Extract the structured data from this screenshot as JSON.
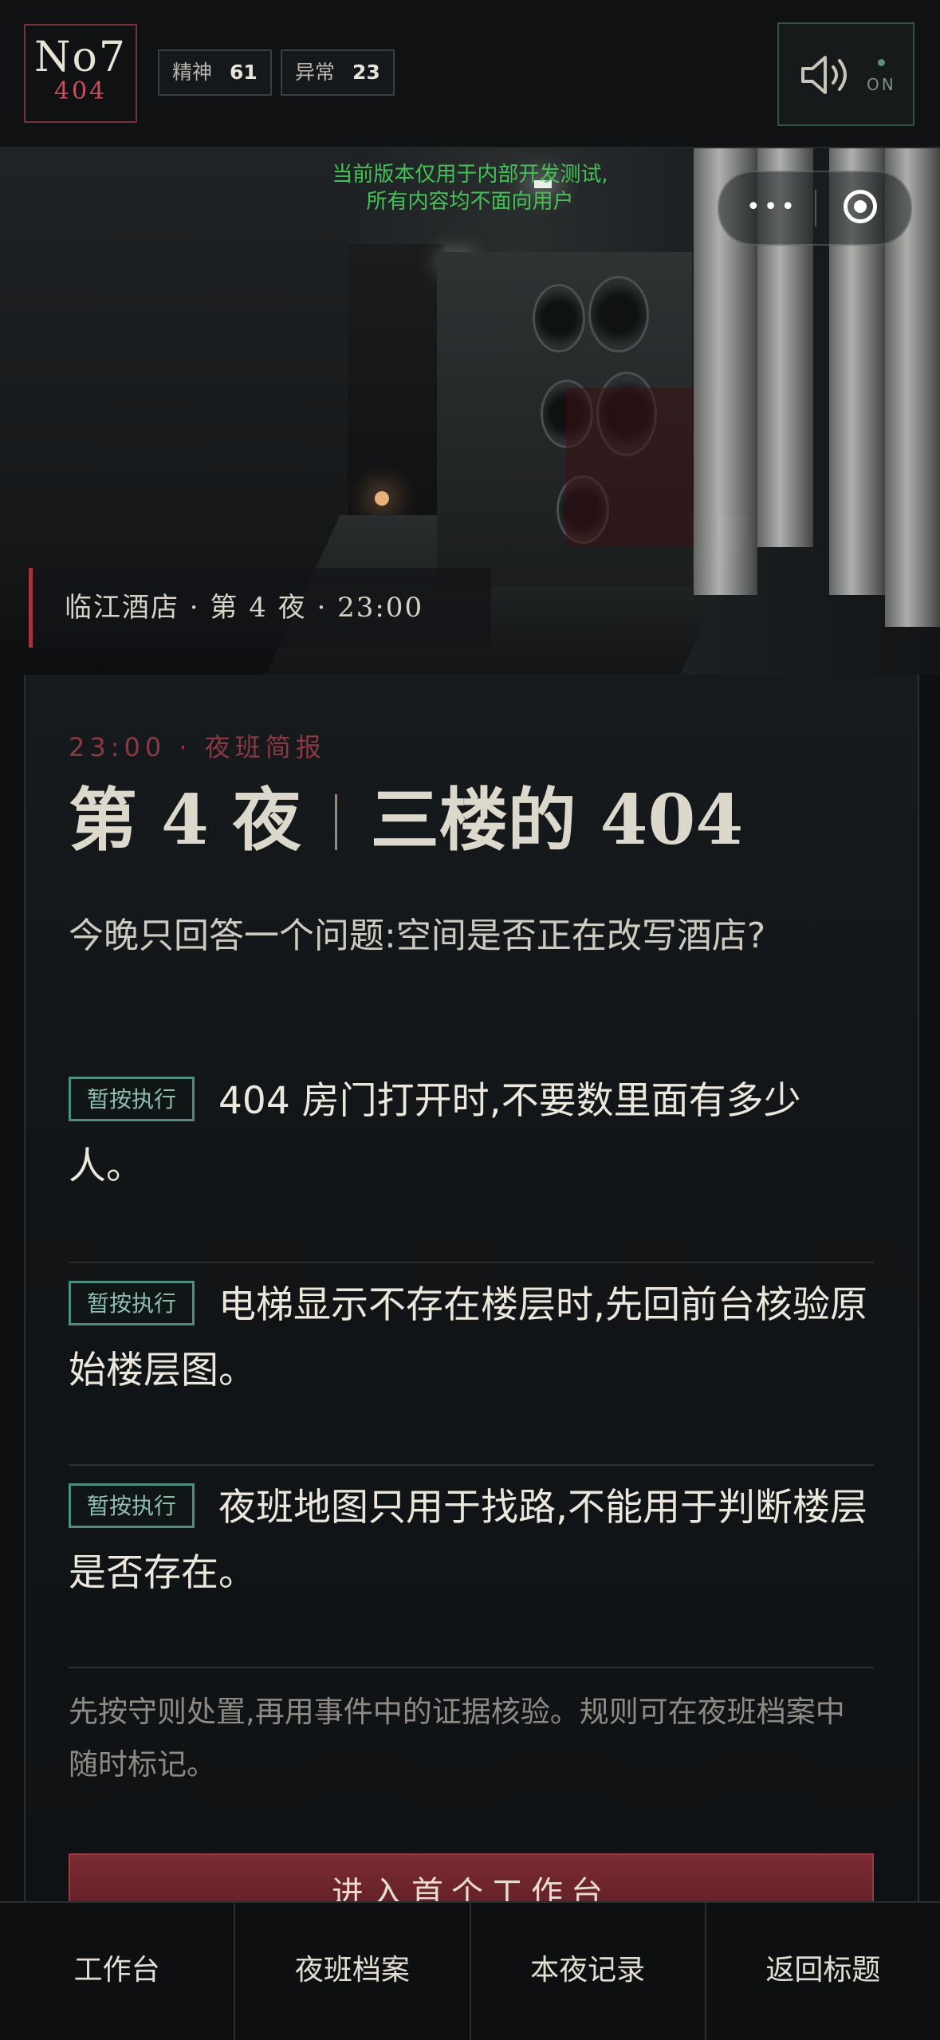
{
  "header": {
    "logo_top": "No7",
    "logo_bottom": "404",
    "stats": [
      {
        "label": "精神",
        "value": "61"
      },
      {
        "label": "异常",
        "value": "23"
      }
    ],
    "sound_state": "ON",
    "sound_icon": "speaker-icon"
  },
  "hero": {
    "dev_note_line1": "当前版本仅用于内部开发测试,",
    "dev_note_line2": "所有内容均不面向用户",
    "location": "临江酒店 · 第 4 夜 · 23:00",
    "capsule": {
      "more_icon": "more-dots-icon",
      "close_icon": "target-icon"
    }
  },
  "briefing": {
    "kicker": "23:00 · 夜班简报",
    "title_left": "第 4 夜",
    "title_right": "三楼的 404",
    "question": "今晚只回答一个问题:空间是否正在改写酒店?",
    "rules": [
      {
        "tag": "暂按执行",
        "text": "404 房门打开时,不要数里面有多少人。"
      },
      {
        "tag": "暂按执行",
        "text": "电梯显示不存在楼层时,先回前台核验原始楼层图。"
      },
      {
        "tag": "暂按执行",
        "text": "夜班地图只用于找路,不能用于判断楼层是否存在。"
      }
    ],
    "footnote": "先按守则处置,再用事件中的证据核验。规则可在夜班档案中随时标记。",
    "cta": "进入首个工作台"
  },
  "nav": [
    {
      "label": "工作台"
    },
    {
      "label": "夜班档案"
    },
    {
      "label": "本夜记录"
    },
    {
      "label": "返回标题"
    }
  ],
  "colors": {
    "accent_red": "#a33440",
    "tag_teal": "#4e8d80",
    "dev_green": "#45c257"
  }
}
